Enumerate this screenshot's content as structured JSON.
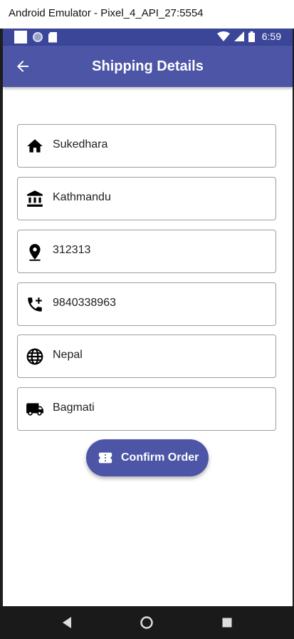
{
  "window": {
    "title": "Android Emulator - Pixel_4_API_27:5554"
  },
  "status_bar": {
    "time": "6:59"
  },
  "app_bar": {
    "title": "Shipping Details",
    "back_icon": "arrow-back-icon"
  },
  "fields": [
    {
      "icon": "home-icon",
      "value": "Sukedhara"
    },
    {
      "icon": "bank-icon",
      "value": "Kathmandu"
    },
    {
      "icon": "location-pin-icon",
      "value": "312313"
    },
    {
      "icon": "phone-add-icon",
      "value": "9840338963"
    },
    {
      "icon": "globe-icon",
      "value": "Nepal"
    },
    {
      "icon": "truck-icon",
      "value": "Bagmati"
    }
  ],
  "confirm_button": {
    "label": "Confirm Order",
    "icon": "ticket-icon"
  },
  "colors": {
    "primary": "#4c55a6",
    "status_bar": "#3b4699",
    "border": "#9e9e9e"
  }
}
